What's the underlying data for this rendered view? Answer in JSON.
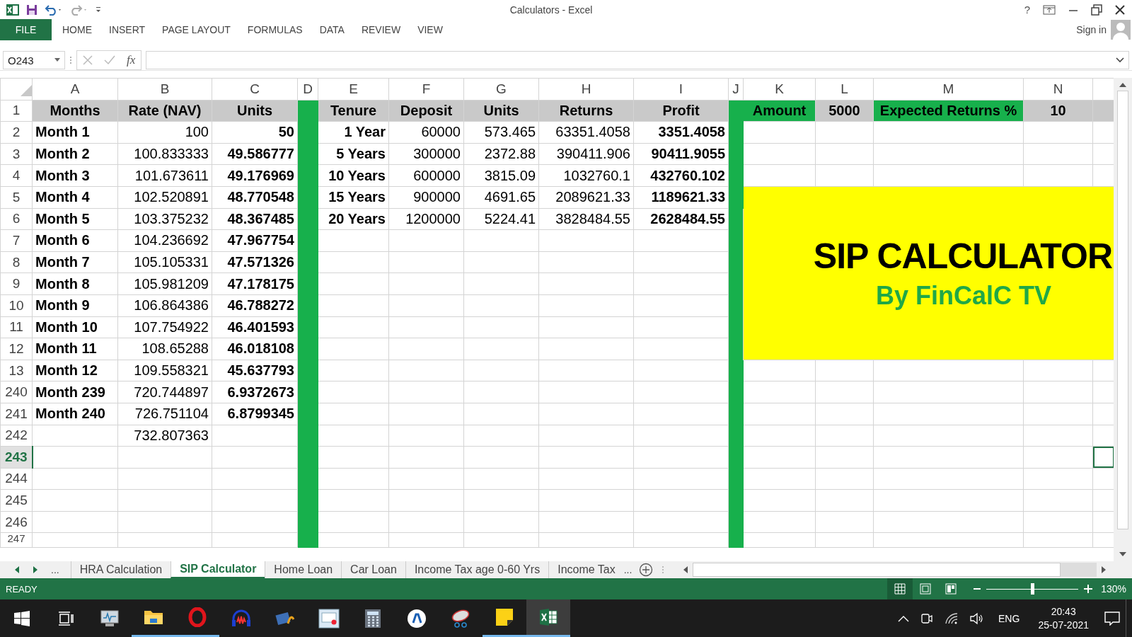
{
  "window": {
    "title": "Calculators - Excel",
    "help": "?",
    "account": "Sign in"
  },
  "ribbon_tabs": [
    {
      "label": "FILE",
      "kind": "file",
      "selected": false
    },
    {
      "label": "HOME",
      "kind": "tab",
      "selected": false
    },
    {
      "label": "INSERT",
      "kind": "tab",
      "selected": false
    },
    {
      "label": "PAGE LAYOUT",
      "kind": "tab",
      "selected": false
    },
    {
      "label": "FORMULAS",
      "kind": "tab",
      "selected": false
    },
    {
      "label": "DATA",
      "kind": "tab",
      "selected": false
    },
    {
      "label": "REVIEW",
      "kind": "tab",
      "selected": false
    },
    {
      "label": "VIEW",
      "kind": "tab",
      "selected": false
    }
  ],
  "formula_bar": {
    "name_box": "O243",
    "fx": "fx"
  },
  "columns": [
    {
      "label": "A",
      "kind": "data"
    },
    {
      "label": "B",
      "kind": "data"
    },
    {
      "label": "C",
      "kind": "data"
    },
    {
      "label": "D",
      "kind": "band"
    },
    {
      "label": "E",
      "kind": "data"
    },
    {
      "label": "F",
      "kind": "data"
    },
    {
      "label": "G",
      "kind": "data"
    },
    {
      "label": "H",
      "kind": "data"
    },
    {
      "label": "I",
      "kind": "data"
    },
    {
      "label": "J",
      "kind": "band"
    },
    {
      "label": "K",
      "kind": "data"
    },
    {
      "label": "L",
      "kind": "data"
    },
    {
      "label": "M",
      "kind": "data"
    },
    {
      "label": "N",
      "kind": "data"
    },
    {
      "kind": "data"
    }
  ],
  "rows": [
    {
      "header": "1",
      "selected": false,
      "cells": [
        {
          "text": "Months",
          "kind": "head",
          "bold": true
        },
        {
          "text": "Rate (NAV)",
          "kind": "head",
          "bold": true
        },
        {
          "text": "Units",
          "kind": "head",
          "bold": true
        },
        null,
        {
          "text": "Tenure",
          "kind": "head",
          "bold": true
        },
        {
          "text": "Deposit",
          "kind": "head",
          "bold": true
        },
        {
          "text": "Units",
          "kind": "head",
          "bold": true
        },
        {
          "text": "Returns",
          "kind": "head",
          "bold": true
        },
        {
          "text": "Profit",
          "kind": "head",
          "bold": true
        },
        null,
        {
          "text": "Amount",
          "kind": "accent",
          "bold": true
        },
        {
          "text": "5000",
          "kind": "head",
          "bold": true
        },
        {
          "text": "Expected Returns %",
          "kind": "accent",
          "bold": true
        },
        {
          "text": "10",
          "kind": "head",
          "bold": true
        },
        {
          "kind": "head"
        }
      ]
    },
    {
      "header": "2",
      "selected": false,
      "cells": [
        {
          "text": "Month 1",
          "kind": "label",
          "bold": true
        },
        {
          "text": "100",
          "kind": "num",
          "bold": false
        },
        {
          "text": "50",
          "kind": "num",
          "bold": true
        },
        null,
        {
          "text": "1 Year",
          "kind": "num",
          "bold": true
        },
        {
          "text": "60000",
          "kind": "num",
          "bold": false
        },
        {
          "text": "573.465",
          "kind": "num",
          "bold": false
        },
        {
          "text": "63351.4058",
          "kind": "num",
          "bold": false
        },
        {
          "text": "3351.4058",
          "kind": "num",
          "bold": true
        }
      ]
    },
    {
      "header": "3",
      "selected": false,
      "cells": [
        {
          "text": "Month 2",
          "kind": "label",
          "bold": true
        },
        {
          "text": "100.833333",
          "kind": "num",
          "bold": false
        },
        {
          "text": "49.586777",
          "kind": "num",
          "bold": true
        },
        null,
        {
          "text": "5 Years",
          "kind": "num",
          "bold": true
        },
        {
          "text": "300000",
          "kind": "num",
          "bold": false
        },
        {
          "text": "2372.88",
          "kind": "num",
          "bold": false
        },
        {
          "text": "390411.906",
          "kind": "num",
          "bold": false
        },
        {
          "text": "90411.9055",
          "kind": "num",
          "bold": true
        }
      ]
    },
    {
      "header": "4",
      "selected": false,
      "cells": [
        {
          "text": "Month 3",
          "kind": "label",
          "bold": true
        },
        {
          "text": "101.673611",
          "kind": "num",
          "bold": false
        },
        {
          "text": "49.176969",
          "kind": "num",
          "bold": true
        },
        null,
        {
          "text": "10 Years",
          "kind": "num",
          "bold": true
        },
        {
          "text": "600000",
          "kind": "num",
          "bold": false
        },
        {
          "text": "3815.09",
          "kind": "num",
          "bold": false
        },
        {
          "text": "1032760.1",
          "kind": "num",
          "bold": false
        },
        {
          "text": "432760.102",
          "kind": "num",
          "bold": true
        }
      ]
    },
    {
      "header": "5",
      "selected": false,
      "banner": {
        "title": "SIP CALCULATOR",
        "subtitle": "By FinCalC TV"
      },
      "cells": [
        {
          "text": "Month 4",
          "kind": "label",
          "bold": true
        },
        {
          "text": "102.520891",
          "kind": "num",
          "bold": false
        },
        {
          "text": "48.770548",
          "kind": "num",
          "bold": true
        },
        null,
        {
          "text": "15 Years",
          "kind": "num",
          "bold": true
        },
        {
          "text": "900000",
          "kind": "num",
          "bold": false
        },
        {
          "text": "4691.65",
          "kind": "num",
          "bold": false
        },
        {
          "text": "2089621.33",
          "kind": "num",
          "bold": false
        },
        {
          "text": "1189621.33",
          "kind": "num",
          "bold": true
        }
      ]
    },
    {
      "header": "6",
      "selected": false,
      "cells": [
        {
          "text": "Month 5",
          "kind": "label",
          "bold": true
        },
        {
          "text": "103.375232",
          "kind": "num",
          "bold": false
        },
        {
          "text": "48.367485",
          "kind": "num",
          "bold": true
        },
        null,
        {
          "text": "20 Years",
          "kind": "num",
          "bold": true
        },
        {
          "text": "1200000",
          "kind": "num",
          "bold": false
        },
        {
          "text": "5224.41",
          "kind": "num",
          "bold": false
        },
        {
          "text": "3828484.55",
          "kind": "num",
          "bold": false
        },
        {
          "text": "2628484.55",
          "kind": "num",
          "bold": true
        }
      ]
    },
    {
      "header": "7",
      "selected": false,
      "cells": [
        {
          "text": "Month 6",
          "kind": "label",
          "bold": true
        },
        {
          "text": "104.236692",
          "kind": "num",
          "bold": false
        },
        {
          "text": "47.967754",
          "kind": "num",
          "bold": true
        }
      ]
    },
    {
      "header": "8",
      "selected": false,
      "cells": [
        {
          "text": "Month 7",
          "kind": "label",
          "bold": true
        },
        {
          "text": "105.105331",
          "kind": "num",
          "bold": false
        },
        {
          "text": "47.571326",
          "kind": "num",
          "bold": true
        }
      ]
    },
    {
      "header": "9",
      "selected": false,
      "cells": [
        {
          "text": "Month 8",
          "kind": "label",
          "bold": true
        },
        {
          "text": "105.981209",
          "kind": "num",
          "bold": false
        },
        {
          "text": "47.178175",
          "kind": "num",
          "bold": true
        }
      ]
    },
    {
      "header": "10",
      "selected": false,
      "cells": [
        {
          "text": "Month 9",
          "kind": "label",
          "bold": true
        },
        {
          "text": "106.864386",
          "kind": "num",
          "bold": false
        },
        {
          "text": "46.788272",
          "kind": "num",
          "bold": true
        }
      ]
    },
    {
      "header": "11",
      "selected": false,
      "cells": [
        {
          "text": "Month 10",
          "kind": "label",
          "bold": true
        },
        {
          "text": "107.754922",
          "kind": "num",
          "bold": false
        },
        {
          "text": "46.401593",
          "kind": "num",
          "bold": true
        }
      ]
    },
    {
      "header": "12",
      "selected": false,
      "cells": [
        {
          "text": "Month 11",
          "kind": "label",
          "bold": true
        },
        {
          "text": "108.65288",
          "kind": "num",
          "bold": false
        },
        {
          "text": "46.018108",
          "kind": "num",
          "bold": true
        }
      ]
    },
    {
      "header": "13",
      "selected": false,
      "cells": [
        {
          "text": "Month 12",
          "kind": "label",
          "bold": true
        },
        {
          "text": "109.558321",
          "kind": "num",
          "bold": false
        },
        {
          "text": "45.637793",
          "kind": "num",
          "bold": true
        }
      ]
    },
    {
      "header": "240",
      "selected": false,
      "cells": [
        {
          "text": "Month 239",
          "kind": "label",
          "bold": true
        },
        {
          "text": "720.744897",
          "kind": "num",
          "bold": false
        },
        {
          "text": "6.9372673",
          "kind": "num",
          "bold": true
        }
      ]
    },
    {
      "header": "241",
      "selected": false,
      "cells": [
        {
          "text": "Month 240",
          "kind": "label",
          "bold": true
        },
        {
          "text": "726.751104",
          "kind": "num",
          "bold": false
        },
        {
          "text": "6.8799345",
          "kind": "num",
          "bold": true
        }
      ]
    },
    {
      "header": "242",
      "selected": false,
      "cells": [
        null,
        {
          "text": "732.807363",
          "kind": "num",
          "bold": false
        }
      ]
    },
    {
      "header": "243",
      "selected": true,
      "cells": [
        null,
        null,
        null,
        null,
        null,
        null,
        null,
        null,
        null,
        null,
        null,
        null,
        null,
        null,
        {
          "kind": "label",
          "selected": true
        }
      ]
    },
    {
      "header": "244",
      "selected": false,
      "cells": []
    },
    {
      "header": "245",
      "selected": false,
      "cells": []
    },
    {
      "header": "246",
      "selected": false,
      "cells": []
    },
    {
      "header": "247",
      "selected": false,
      "cells": []
    }
  ],
  "sheet_tabs": {
    "more_left": "...",
    "tabs": [
      {
        "label": "HRA Calculation",
        "selected": false
      },
      {
        "label": "SIP Calculator",
        "selected": true
      },
      {
        "label": "Home Loan",
        "selected": false
      },
      {
        "label": "Car Loan",
        "selected": false
      },
      {
        "label": "Income Tax age 0-60 Yrs",
        "selected": false
      },
      {
        "label": "Income Tax",
        "selected": false
      }
    ],
    "more_right": "..."
  },
  "status_bar": {
    "mode": "READY",
    "views": [
      {
        "kind": "normal",
        "selected": true
      },
      {
        "kind": "page-layout",
        "selected": false
      },
      {
        "kind": "page-break",
        "selected": false
      }
    ],
    "zoom": {
      "level": 0.5,
      "reading": "130%"
    }
  },
  "taskbar": {
    "apps": [
      {
        "kind": "windows",
        "running": false,
        "selected": false
      },
      {
        "kind": "taskview",
        "running": false,
        "selected": false
      },
      {
        "kind": "monitor",
        "running": false,
        "selected": false
      },
      {
        "kind": "folder",
        "running": true,
        "selected": false
      },
      {
        "kind": "ring",
        "running": true,
        "selected": false
      },
      {
        "kind": "headphones",
        "running": false,
        "selected": false
      },
      {
        "kind": "film",
        "running": false,
        "selected": false
      },
      {
        "kind": "screen",
        "running": false,
        "selected": false
      },
      {
        "kind": "calculator",
        "running": false,
        "selected": false
      },
      {
        "kind": "badge",
        "running": false,
        "selected": false
      },
      {
        "kind": "dish",
        "running": false,
        "selected": false
      },
      {
        "kind": "note",
        "running": true,
        "selected": false
      },
      {
        "kind": "excel",
        "running": true,
        "selected": true
      }
    ],
    "tray": {
      "language": "ENG",
      "time": "20:43",
      "date": "25-07-2021"
    }
  }
}
